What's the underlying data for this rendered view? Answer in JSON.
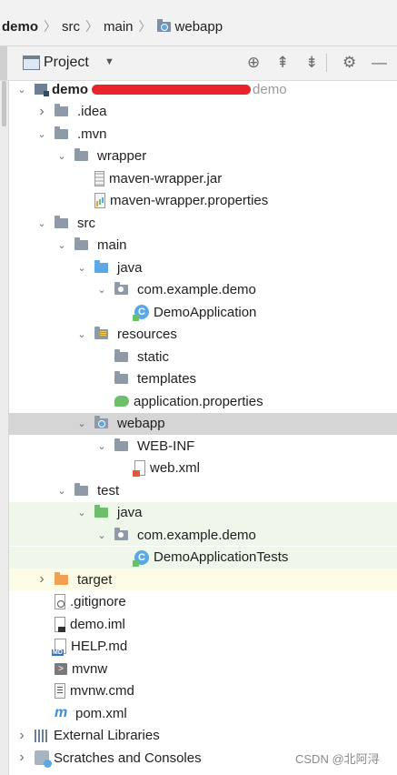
{
  "breadcrumb": {
    "items": [
      {
        "label": "demo",
        "bold": true
      },
      {
        "label": "src"
      },
      {
        "label": "main"
      },
      {
        "label": "webapp",
        "icon": "web-folder-icon"
      }
    ]
  },
  "toolbar": {
    "title": "Project",
    "icons": [
      "locate-icon",
      "collapse-all-icon",
      "expand-all-icon",
      "gear-icon",
      "hide-icon"
    ]
  },
  "tree": [
    {
      "depth": 0,
      "arrow": "down",
      "icon": "module",
      "label": "demo",
      "suffix": "demo",
      "redacted": true,
      "bold": true
    },
    {
      "depth": 1,
      "arrow": "right",
      "icon": "folder",
      "label": ".idea"
    },
    {
      "depth": 1,
      "arrow": "down",
      "icon": "folder",
      "label": ".mvn"
    },
    {
      "depth": 2,
      "arrow": "down",
      "icon": "folder",
      "label": "wrapper"
    },
    {
      "depth": 3,
      "arrow": "",
      "icon": "jar",
      "label": "maven-wrapper.jar"
    },
    {
      "depth": 3,
      "arrow": "",
      "icon": "properties",
      "label": "maven-wrapper.properties"
    },
    {
      "depth": 1,
      "arrow": "down",
      "icon": "folder",
      "label": "src"
    },
    {
      "depth": 2,
      "arrow": "down",
      "icon": "folder",
      "label": "main"
    },
    {
      "depth": 3,
      "arrow": "down",
      "icon": "folder-blue",
      "label": "java"
    },
    {
      "depth": 4,
      "arrow": "down",
      "icon": "package",
      "label": "com.example.demo"
    },
    {
      "depth": 5,
      "arrow": "",
      "icon": "class",
      "label": "DemoApplication"
    },
    {
      "depth": 3,
      "arrow": "down",
      "icon": "resources",
      "label": "resources"
    },
    {
      "depth": 4,
      "arrow": "",
      "icon": "folder",
      "label": "static"
    },
    {
      "depth": 4,
      "arrow": "",
      "icon": "folder",
      "label": "templates"
    },
    {
      "depth": 4,
      "arrow": "",
      "icon": "spring",
      "label": "application.properties"
    },
    {
      "depth": 3,
      "arrow": "down",
      "icon": "web",
      "label": "webapp",
      "selected": true
    },
    {
      "depth": 4,
      "arrow": "down",
      "icon": "folder",
      "label": "WEB-INF"
    },
    {
      "depth": 5,
      "arrow": "",
      "icon": "xml",
      "label": "web.xml"
    },
    {
      "depth": 2,
      "arrow": "down",
      "icon": "folder",
      "label": "test"
    },
    {
      "depth": 3,
      "arrow": "down",
      "icon": "folder-green",
      "label": "java",
      "test": true
    },
    {
      "depth": 4,
      "arrow": "down",
      "icon": "package",
      "label": "com.example.demo",
      "test": true
    },
    {
      "depth": 5,
      "arrow": "",
      "icon": "class",
      "label": "DemoApplicationTests",
      "test": true
    },
    {
      "depth": 1,
      "arrow": "right",
      "icon": "folder-orange",
      "label": "target",
      "excluded": true
    },
    {
      "depth": 1,
      "arrow": "",
      "icon": "gitignore",
      "label": ".gitignore"
    },
    {
      "depth": 1,
      "arrow": "",
      "icon": "iml",
      "label": "demo.iml"
    },
    {
      "depth": 1,
      "arrow": "",
      "icon": "md",
      "label": "HELP.md"
    },
    {
      "depth": 1,
      "arrow": "",
      "icon": "shell",
      "label": "mvnw"
    },
    {
      "depth": 1,
      "arrow": "",
      "icon": "cmd",
      "label": "mvnw.cmd"
    },
    {
      "depth": 1,
      "arrow": "",
      "icon": "pom",
      "label": "pom.xml"
    },
    {
      "depth": 0,
      "arrow": "right",
      "icon": "libraries",
      "label": "External Libraries"
    },
    {
      "depth": 0,
      "arrow": "right",
      "icon": "scratches",
      "label": "Scratches and Consoles"
    }
  ],
  "watermark": "CSDN @北阿浔"
}
